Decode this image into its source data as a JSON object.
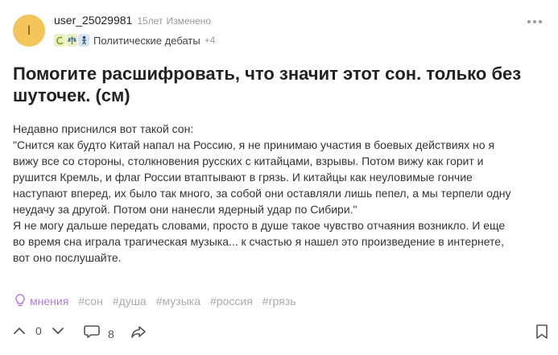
{
  "author": {
    "avatar_letter": "I",
    "username": "user_25029981",
    "time": "15лет",
    "edited": "Изменено",
    "category": "Политические дебаты",
    "more_categories": "+4"
  },
  "post": {
    "title": "Помогите расшифровать, что значит этот сон. только без шуточек. (см)",
    "body_lines": [
      "Недавно приснился вот такой сон:",
      "\"Снится как будто Китай напал на Россию, я не принимаю участия в боевых действиях но я",
      "вижу все со стороны, столкновения русских с китайцами, взрывы. Потом вижу как горит и",
      "рушится Кремль, и флаг России втаптывают в грязь. И китайцы как неуловимые гончие",
      "наступают вперед, их было так много, за собой они оставляли лишь пепел, а мы терпели одну",
      "неудачу за другой. Потом они нанесли ядерный удар по Сибири.\"",
      "Я не могу дальше передать словами, просто в душе такое чувство отчаяния возникло. И еще",
      "во время сна играла трагическая музыка... к счастью я нашел это произведение в интернете,",
      "вот оно послушайте."
    ]
  },
  "tags": {
    "opinions": "мнения",
    "items": [
      "#сон",
      "#душа",
      "#музыка",
      "#россия",
      "#грязь"
    ]
  },
  "actions": {
    "votes": "0",
    "comments": "8"
  },
  "colors": {
    "avatar_bg": "#f3c55b",
    "opinions_accent": "#b07cdc",
    "muted": "#aaaaaa"
  }
}
